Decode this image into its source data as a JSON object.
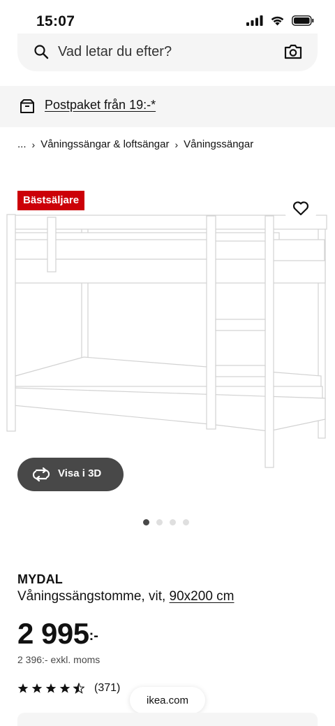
{
  "status_bar": {
    "time": "15:07"
  },
  "search": {
    "placeholder": "Vad letar du efter?"
  },
  "delivery": {
    "label": "Postpaket från 19:-*"
  },
  "breadcrumb": {
    "items": [
      "...",
      "Våningssängar & loftsängar",
      "Våningssängar"
    ],
    "separator": "›"
  },
  "product_image": {
    "badge": "Bästsäljare",
    "view3d_label": "Visa i 3D",
    "carousel": {
      "count": 4,
      "active_index": 0
    }
  },
  "product": {
    "name": "MYDAL",
    "description": "Våningssängstomme, vit, ",
    "size_link": "90x200 cm",
    "price_main": "2 995",
    "price_suffix": ":-",
    "price_excl_vat": "2 396:- exkl. moms",
    "rating": {
      "stars": 4.5,
      "max": 5,
      "count_text": "(371)"
    }
  },
  "browser": {
    "url": "ikea.com"
  },
  "colors": {
    "badge_red": "#cc0008",
    "button_dark": "#484848",
    "surface_grey": "#f5f5f5"
  }
}
